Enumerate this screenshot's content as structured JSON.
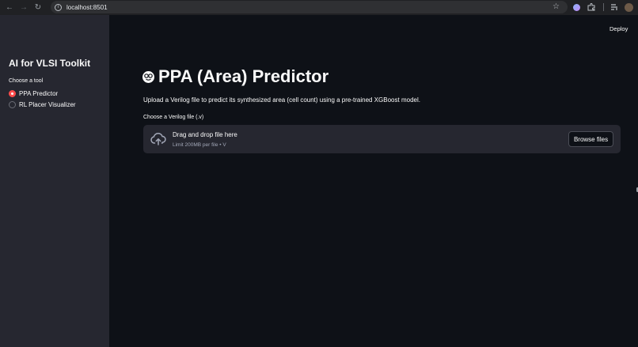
{
  "browser": {
    "url": "localhost:8501",
    "icons": [
      "back-arrow-icon",
      "forward-arrow-icon",
      "reload-icon",
      "site-info-icon",
      "bookmark-star-icon",
      "extension-icon",
      "puzzle-icon",
      "media-icon",
      "profile-avatar-icon"
    ]
  },
  "sidebar": {
    "title": "AI for VLSI Toolkit",
    "radio_label": "Choose a tool",
    "options": [
      {
        "label": "PPA Predictor",
        "selected": true
      },
      {
        "label": "RL Placer Visualizer",
        "selected": false
      }
    ]
  },
  "header": {
    "deploy_label": "Deploy"
  },
  "main": {
    "title": "PPA (Area) Predictor",
    "title_icon": "nerd-face-icon",
    "description": "Upload a Verilog file to predict its synthesized area (cell count) using a pre-trained XGBoost model.",
    "uploader": {
      "label": "Choose a Verilog file (.v)",
      "drop_text": "Drag and drop file here",
      "limit_text": "Limit 200MB per file • V",
      "browse_label": "Browse files",
      "icon": "cloud-upload-icon"
    }
  },
  "colors": {
    "background": "#0e1117",
    "sidebar_bg": "#262730",
    "accent": "#ff4b4b",
    "text": "#fafafa"
  }
}
